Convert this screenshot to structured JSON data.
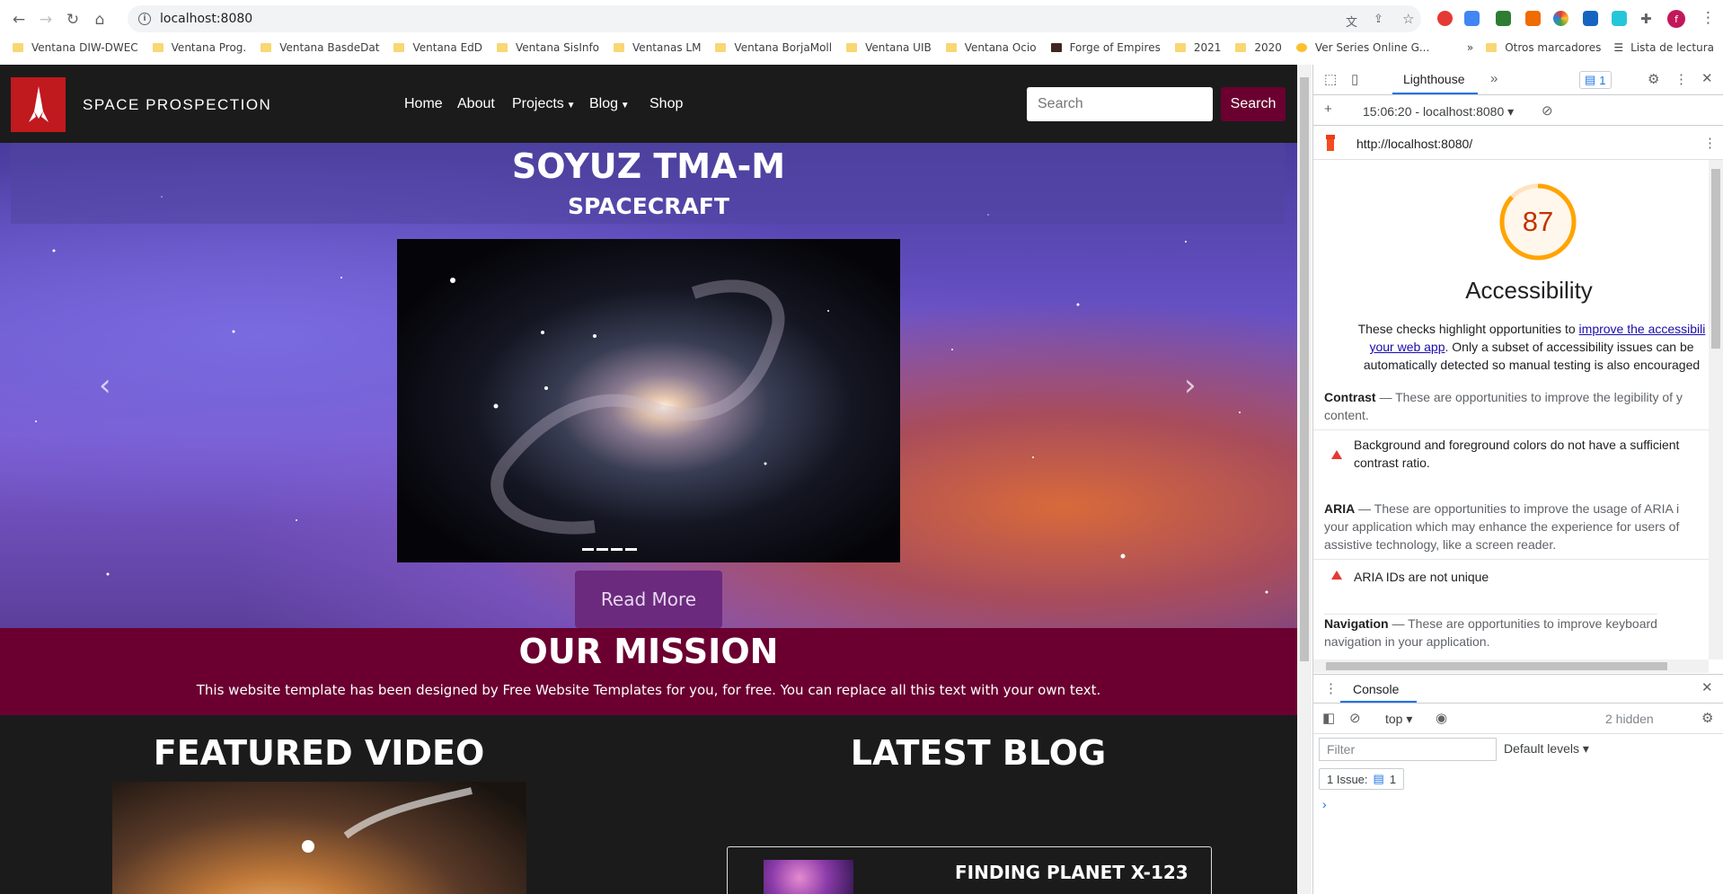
{
  "browser": {
    "url": "localhost:8080",
    "bookmarks": [
      "Ventana DIW-DWEC",
      "Ventana Prog.",
      "Ventana BasdeDat",
      "Ventana EdD",
      "Ventana SisInfo",
      "Ventanas LM",
      "Ventana BorjaMoll",
      "Ventana UIB",
      "Ventana Ocio",
      "Forge of Empires",
      "2021",
      "2020",
      "Ver Series Online G..."
    ],
    "bookmarks_overflow": "»",
    "other_bookmarks": "Otros marcadores",
    "reading_list": "Lista de lectura",
    "avatar_letter": "f"
  },
  "site": {
    "brand": "SPACE PROSPECTION",
    "nav": [
      "Home",
      "About",
      "Projects",
      "Blog",
      "Shop"
    ],
    "search_placeholder": "Search",
    "search_button": "Search",
    "hero_title": "SOYUZ TMA-M",
    "hero_subtitle": "SPACECRAFT",
    "read_more": "Read More",
    "mission_title": "OUR MISSION",
    "mission_text": "This website template has been designed by Free Website Templates for you, for free. You can replace all this text with your own text.",
    "featured_video_title": "FEATURED VIDEO",
    "latest_blog_title": "LATEST BLOG",
    "blog_post_title": "FINDING PLANET X-123",
    "colors": {
      "brand_red": "#c0191e",
      "maroon": "#6b0030",
      "dark": "#1b1b1b"
    }
  },
  "devtools": {
    "tab": "Lighthouse",
    "issues_count": "1",
    "report_time": "15:06:20 - localhost:8080",
    "report_url": "http://localhost:8080/",
    "score": 87,
    "category": "Accessibility",
    "desc_line1_pre": "These checks highlight opportunities to ",
    "desc_link1": "improve the accessibili",
    "desc_link2": "your web app",
    "desc_line2_post": ". Only a subset of accessibility issues can be",
    "desc_line3": "automatically detected so manual testing is also encouraged",
    "contrast_head": "Contrast",
    "contrast_desc1": " — These are opportunities to improve the legibility of y",
    "contrast_desc2": "content.",
    "audit1_line1": "Background and foreground colors do not have a sufficient",
    "audit1_line2": "contrast ratio.",
    "aria_head": "ARIA",
    "aria_desc1": " — These are opportunities to improve the usage of ARIA i",
    "aria_desc2": "your application which may enhance the experience for users of",
    "aria_desc3": "assistive technology, like a screen reader.",
    "audit2": "ARIA IDs are not unique",
    "nav_head": "Navigation",
    "nav_desc1": " — These are opportunities to improve keyboard",
    "nav_desc2": "navigation in your application.",
    "console_tab": "Console",
    "context": "top",
    "hidden": "2 hidden",
    "filter_placeholder": "Filter",
    "levels": "Default levels",
    "issue_label": "1 Issue:",
    "issue_count": "1"
  }
}
